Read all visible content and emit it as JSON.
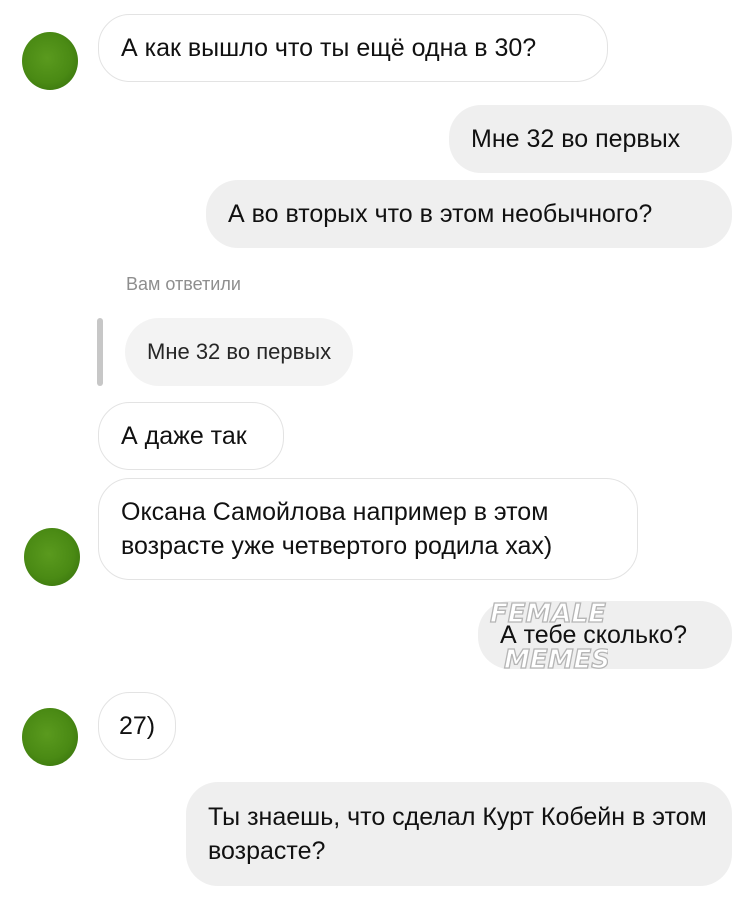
{
  "messages": [
    {
      "text": "А как вышло что ты ещё одна в 30?"
    },
    {
      "text": "Мне 32 во первых"
    },
    {
      "text": "А во вторых что в этом необычного?"
    },
    {
      "text": "А даже так"
    },
    {
      "text": "Оксана Самойлова например в этом возрасте уже четвертого родила хах)"
    },
    {
      "text": "А тебе сколько?"
    },
    {
      "text": "27)"
    },
    {
      "text": "Ты знаешь, что сделал Курт Кобейн в этом возрасте?"
    }
  ],
  "reply": {
    "label": "Вам ответили",
    "quoted_text": "Мне 32 во первых"
  },
  "watermark": {
    "line1": "FEMALE",
    "line2": "MEMES"
  },
  "colors": {
    "avatar": "#4a8a14",
    "incoming_bubble": "#ffffff",
    "outgoing_bubble": "#efefef",
    "watermark": "#ffffff"
  }
}
